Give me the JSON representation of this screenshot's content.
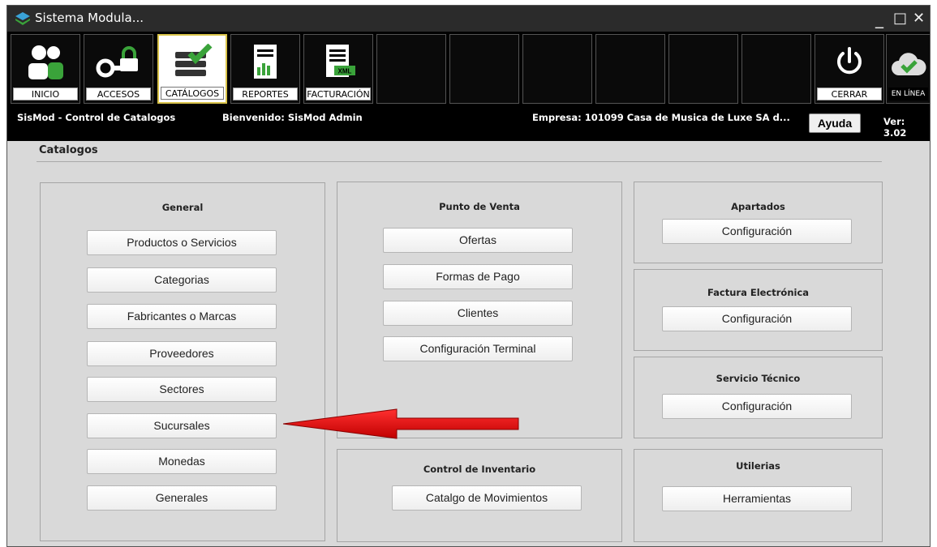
{
  "window": {
    "title": "Sistema Modula...",
    "minimize": "_",
    "maximize": "□",
    "close": "✕"
  },
  "toolbar": {
    "tiles": [
      {
        "label": "INICIO",
        "icon": "users-icon"
      },
      {
        "label": "ACCESOS",
        "icon": "key-lock-icon"
      },
      {
        "label": "CATÁLOGOS",
        "icon": "catalog-checklist-icon",
        "active": true
      },
      {
        "label": "REPORTES",
        "icon": "report-chart-icon"
      },
      {
        "label": "FACTURACIÓN",
        "icon": "xml-invoice-icon"
      }
    ],
    "close_label": "CERRAR",
    "online_label": "EN LÍNEA"
  },
  "infobar": {
    "module": "SisMod - Control de Catalogos",
    "welcome": "Bienvenido: SisMod Admin",
    "company": "Empresa: 101099  Casa de Musica de Luxe SA d...",
    "help_label": "Ayuda",
    "version": "Ver: 3.02"
  },
  "main": {
    "section_title": "Catalogos",
    "general": {
      "title": "General",
      "buttons": [
        "Productos o Servicios",
        "Categorias",
        "Fabricantes o Marcas",
        "Proveedores",
        "Sectores",
        "Sucursales",
        "Monedas",
        "Generales"
      ]
    },
    "punto_venta": {
      "title": "Punto de Venta",
      "buttons": [
        "Ofertas",
        "Formas de Pago",
        "Clientes",
        "Configuración Terminal"
      ]
    },
    "control_inventario": {
      "title": "Control de Inventario",
      "buttons": [
        "Catalgo de Movimientos"
      ]
    },
    "apartados": {
      "title": "Apartados",
      "button": "Configuración"
    },
    "factura": {
      "title": "Factura Electrónica",
      "button": "Configuración"
    },
    "servicio": {
      "title": "Servicio Técnico",
      "button": "Configuración"
    },
    "utilerias": {
      "title": "Utilerias",
      "button": "Herramientas"
    }
  },
  "colors": {
    "toolbar_bg": "#000000",
    "active_tile_border": "#d9c34a",
    "arrow": "#e01010",
    "accent_green": "#3aa33a"
  }
}
